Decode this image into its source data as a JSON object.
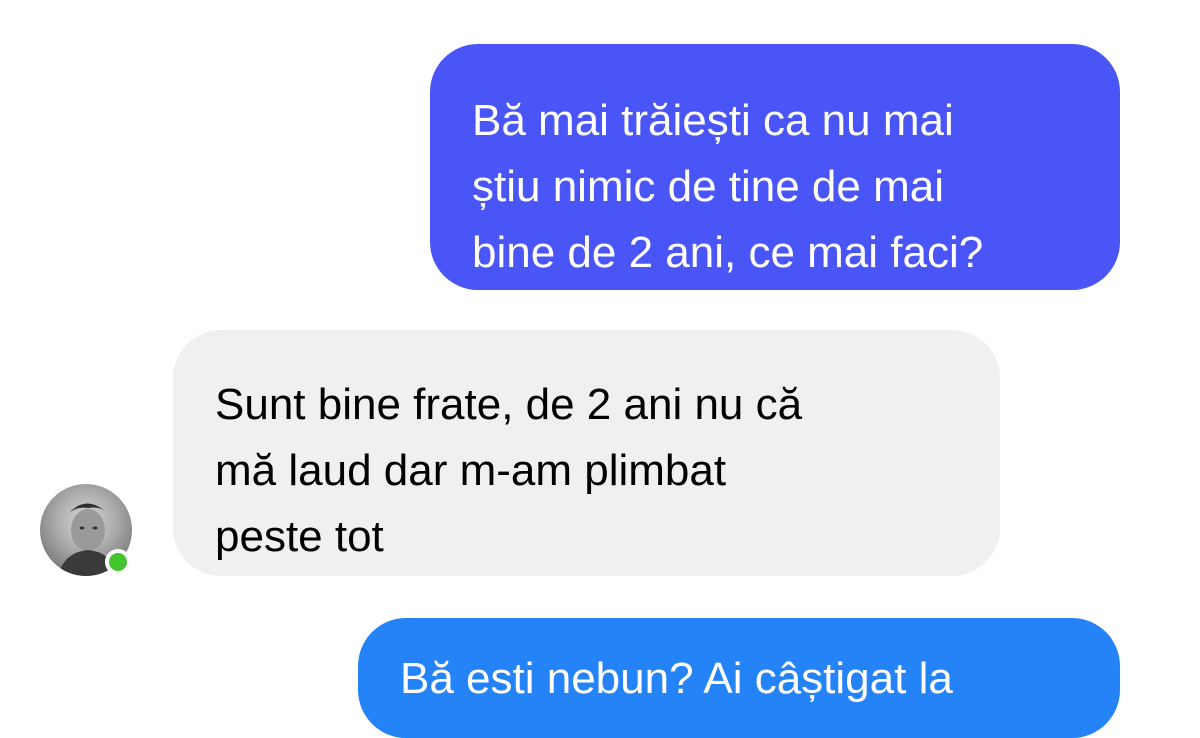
{
  "messages": [
    {
      "direction": "outgoing",
      "text": "Bă mai trăiești ca nu mai\nștiu nimic de tine de mai\nbine de 2 ani, ce mai faci?"
    },
    {
      "direction": "incoming",
      "text": "Sunt bine frate, de 2 ani nu că\nmă laud dar m-am plimbat\npeste tot"
    },
    {
      "direction": "outgoing",
      "text": "Bă esti nebun? Ai câștigat la"
    }
  ],
  "contact": {
    "avatar_icon": "profile-photo",
    "online_status_icon": "online-dot-icon",
    "online_color": "#44c52d"
  },
  "colors": {
    "outgoing_primary": "#4a55f7",
    "outgoing_secondary": "#2583f8",
    "incoming": "#f1f0f0"
  }
}
